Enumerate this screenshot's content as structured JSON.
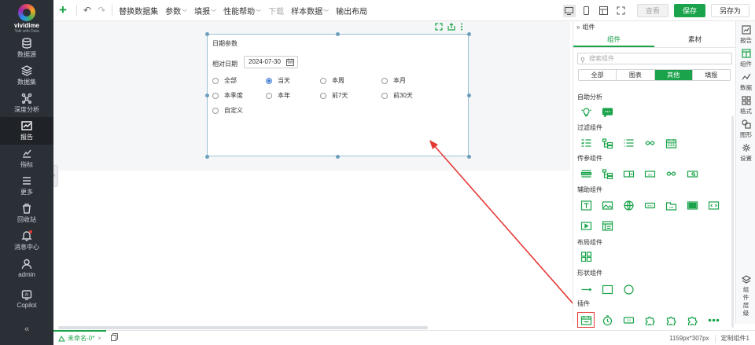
{
  "app": {
    "logo_name": "vividime",
    "logo_sub": "Talk with Data"
  },
  "nav": [
    {
      "label": "数据源",
      "icon": "database-icon"
    },
    {
      "label": "数据集",
      "icon": "cube-icon"
    },
    {
      "label": "深度分析",
      "icon": "network-icon"
    },
    {
      "label": "报告",
      "icon": "chart-report-icon",
      "active": true
    },
    {
      "label": "指标",
      "icon": "metric-icon"
    },
    {
      "label": "更多",
      "icon": "menu-icon"
    },
    {
      "label": "回收站",
      "icon": "trash-icon"
    },
    {
      "label": "消息中心",
      "icon": "bell-icon"
    },
    {
      "label": "admin",
      "icon": "user-icon"
    },
    {
      "label": "Copilot",
      "icon": "ai-icon"
    }
  ],
  "toolbar": {
    "menu": [
      {
        "label": "替换数据集",
        "caret": false
      },
      {
        "label": "参数",
        "caret": true
      },
      {
        "label": "填报",
        "caret": true
      },
      {
        "label": "性能帮助",
        "caret": true
      },
      {
        "label": "下载",
        "caret": false,
        "disabled": true
      },
      {
        "label": "样本数据",
        "caret": true
      },
      {
        "label": "输出布局",
        "caret": false
      }
    ],
    "preview": "查看",
    "save": "保存",
    "save_as": "另存为"
  },
  "widget": {
    "title": "日期参数",
    "field_label": "相对日期",
    "date_value": "2024-07-30",
    "options": [
      {
        "label": "全部",
        "checked": false
      },
      {
        "label": "当天",
        "checked": true
      },
      {
        "label": "本周",
        "checked": false
      },
      {
        "label": "本月",
        "checked": false
      },
      {
        "label": "本季度",
        "checked": false
      },
      {
        "label": "本年",
        "checked": false
      },
      {
        "label": "前7天",
        "checked": false
      },
      {
        "label": "前30天",
        "checked": false
      },
      {
        "label": "自定义",
        "checked": false
      }
    ]
  },
  "panel": {
    "title": "组件",
    "tabs": [
      "组件",
      "素材"
    ],
    "active_tab": 0,
    "search_placeholder": "搜索组件",
    "segments": [
      "全部",
      "图表",
      "其他",
      "填报"
    ],
    "active_segment": 2,
    "sections": [
      {
        "title": "自助分析",
        "icons": [
          "ai-bulb-icon",
          "chat-icon"
        ]
      },
      {
        "title": "过滤组件",
        "icons": [
          "list-filter-icon",
          "tree-filter-icon",
          "list-icon",
          "range-slider-icon",
          "calendar-grid-icon"
        ]
      },
      {
        "title": "传参组件",
        "icons": [
          "list-param-icon",
          "tree-param-icon",
          "combo-icon",
          "input-icon",
          "slider-icon",
          "search-box-icon"
        ]
      },
      {
        "title": "辅助组件",
        "icons": [
          "text-icon",
          "image-icon",
          "web-icon",
          "button-icon",
          "tab-icon",
          "panel-icon",
          "code-icon",
          "video-icon",
          "table-text-icon"
        ]
      },
      {
        "title": "布局组件",
        "icons": [
          "layout-grid-icon"
        ]
      },
      {
        "title": "形状组件",
        "icons": [
          "line-icon",
          "rectangle-icon",
          "circle-icon"
        ]
      },
      {
        "title": "插件",
        "icons": [
          "calendar-plugin-icon",
          "timer-icon",
          "badge-plugin-icon",
          "puzzle-icon",
          "puzzle-icon",
          "puzzle-icon",
          "more-icon"
        ]
      }
    ]
  },
  "rightbar": [
    {
      "label": "报告",
      "icon": "report-icon"
    },
    {
      "label": "组件",
      "icon": "component-icon",
      "active": true
    },
    {
      "label": "数据",
      "icon": "data-icon"
    },
    {
      "label": "格式",
      "icon": "format-icon"
    },
    {
      "label": "图形",
      "icon": "shape-icon"
    },
    {
      "label": "设置",
      "icon": "settings-icon"
    },
    {
      "label": "组件层级",
      "icon": "layers-icon"
    }
  ],
  "status": {
    "doc_tab": "未命名-0*",
    "size": "1159px*307px",
    "selection": "定制组件1"
  },
  "colors": {
    "accent": "#1aa34a",
    "nav_bg": "#2b2f36",
    "arrow": "#e53935",
    "radio_checked": "#3b7bd4"
  }
}
